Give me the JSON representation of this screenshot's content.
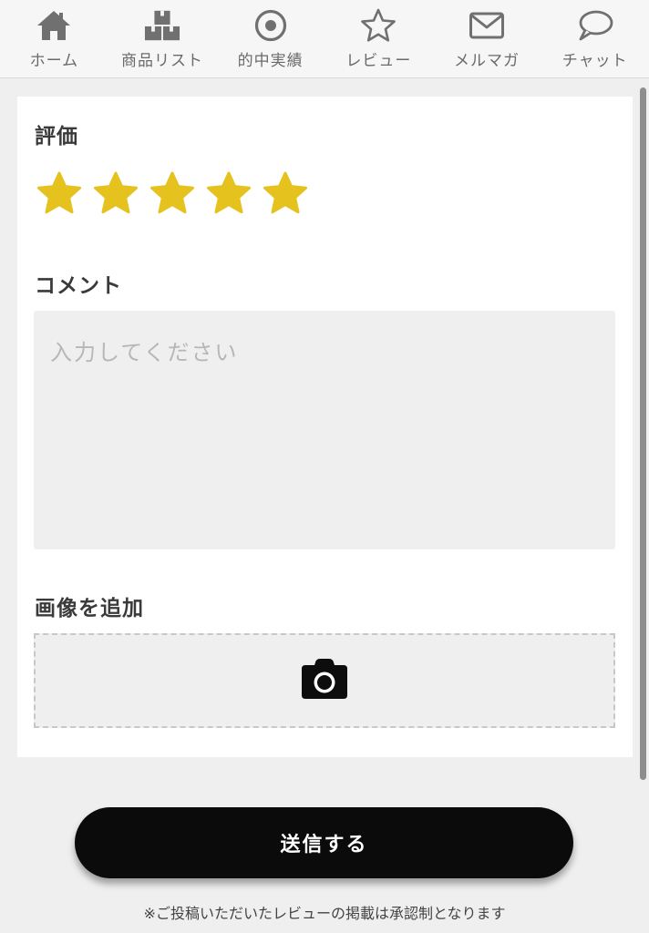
{
  "nav": {
    "items": [
      {
        "label": "ホーム",
        "icon": "home-icon"
      },
      {
        "label": "商品リスト",
        "icon": "boxes-icon"
      },
      {
        "label": "的中実績",
        "icon": "target-icon"
      },
      {
        "label": "レビュー",
        "icon": "star-outline-icon"
      },
      {
        "label": "メルマガ",
        "icon": "mail-icon"
      },
      {
        "label": "チャット",
        "icon": "chat-bubble-icon"
      }
    ]
  },
  "form": {
    "rating_title": "評価",
    "rating_value": 5,
    "rating_max": 5,
    "star_color": "#e6c21e",
    "comment_title": "コメント",
    "comment_placeholder": "入力してください",
    "comment_value": "",
    "image_title": "画像を追加",
    "image_icon": "camera-icon"
  },
  "submit": {
    "label": "送信する"
  },
  "notice": "※ご投稿いただいたレビューの掲載は承認制となります"
}
